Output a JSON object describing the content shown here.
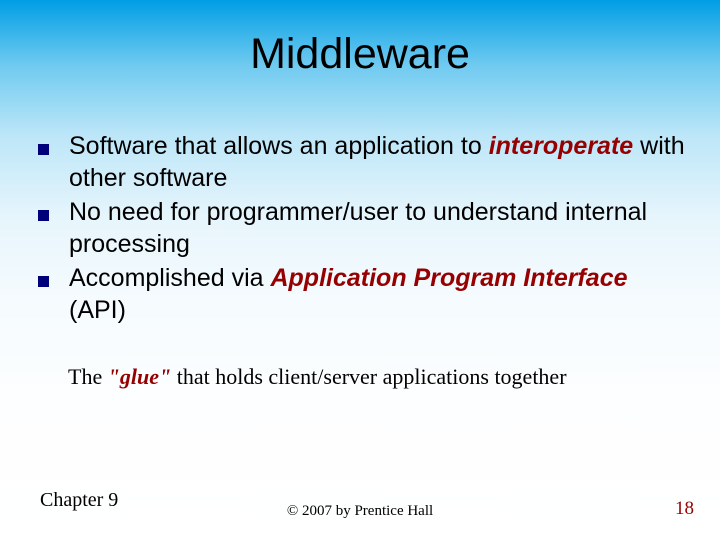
{
  "title": "Middleware",
  "bullets": [
    {
      "pre": "Software that allows an application to ",
      "accent": "interoperate",
      "post": " with other software"
    },
    {
      "pre": "No need for programmer/user to understand internal processing",
      "accent": "",
      "post": ""
    },
    {
      "pre": "Accomplished via ",
      "accent": "Application Program Interface",
      "post": " (API)"
    }
  ],
  "subline": {
    "pre": "The ",
    "accent": "\"glue\"",
    "post": " that holds client/server applications together"
  },
  "footer": {
    "left": "Chapter 9",
    "center": "© 2007 by Prentice Hall",
    "right": "18"
  }
}
